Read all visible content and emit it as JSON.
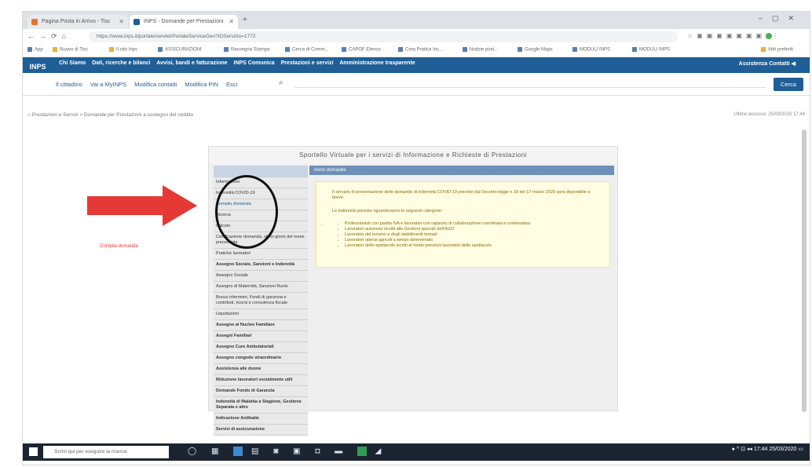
{
  "browser": {
    "tabs": [
      {
        "label": "Pagina Posta in Arrivo - Tisc",
        "favicon_color": "#e8742a"
      },
      {
        "label": "INPS - Domande per Prestazioni",
        "favicon_color": "#1f5e96"
      }
    ],
    "url": "https://www.inps.it/portale/servlet/PortaleServiceGen?IDServizio=1772",
    "bookmarks": [
      "App",
      "Nuovo di Tisc",
      "Il sito Inps",
      "ASSICURAZIONI",
      "Rassegna Stampa",
      "Cerca di Comm...",
      "CAPOF Elenco",
      "Crea Pratica Inc...",
      "Notizie post...",
      "Google Maps",
      "MODULI INPS",
      "MODULI INPS",
      "Altri preferiti"
    ]
  },
  "site": {
    "logo_text": "INPS",
    "top_nav": [
      "Chi Siamo",
      "Dati, ricerche e bilanci",
      "Avvisi, bandi e fatturazione",
      "INPS Comunica",
      "Prestazioni e servizi",
      "Amministrazione trasparente"
    ],
    "top_right": [
      "Assistenza",
      "Contatti"
    ],
    "sub_nav": [
      "Il cittadino",
      "Vai a MyINPS",
      "Modifica contatti",
      "Modifica PIN",
      "Esci"
    ],
    "search_button": "Cerca",
    "breadcrumb": "Prestazioni e Servizi > Domande per Prestazioni a sostegno del reddito",
    "last_update": "Ultimo accesso: 25/03/2020 17:44"
  },
  "portal": {
    "title": "Sportello Virtuale per i servizi di Informazione e Richieste di Prestazioni",
    "menu": [
      {
        "label": "",
        "style": "head"
      },
      {
        "label": "Informazioni",
        "style": "normal"
      },
      {
        "label": "Indennità COVID-19",
        "style": "normal"
      },
      {
        "label": "Compila domanda",
        "style": "sub"
      },
      {
        "label": "Ricerca",
        "style": "normal"
      },
      {
        "label": "Calcolo",
        "style": "normal"
      },
      {
        "label": "Certificazione domanda, ultimi giorni del mese precedente",
        "style": "normal"
      },
      {
        "label": "Pratiche lavoratori",
        "style": "normal"
      },
      {
        "label": "Assegno Sociale, Sanzioni e Indennità",
        "style": "bold"
      },
      {
        "label": "Assegno Sociale",
        "style": "normal"
      },
      {
        "label": "Assegno di Maternità, Sanzioni Ruolo",
        "style": "normal"
      },
      {
        "label": "Bonus infermieri, Fondi di garanzia e contributi, ricorsi e consulenza fiscale",
        "style": "normal"
      },
      {
        "label": "Liquidazioni",
        "style": "normal"
      },
      {
        "label": "Assegno al Nucleo Familiare",
        "style": "bold"
      },
      {
        "label": "Assegni Familiari",
        "style": "bold"
      },
      {
        "label": "Assegno Cure Ambulatoriali",
        "style": "bold"
      },
      {
        "label": "Assegno congedo straordinario",
        "style": "bold"
      },
      {
        "label": "Assistenza alle donne",
        "style": "bold"
      },
      {
        "label": "Riduzione lavoratori socialmente utili",
        "style": "bold"
      },
      {
        "label": "Domande Fondo di Garanzia",
        "style": "bold"
      },
      {
        "label": "Indennità di Malattia a Stagione, Gestione Separata e altre",
        "style": "bold"
      },
      {
        "label": "Indicazione Antibatte",
        "style": "bold"
      },
      {
        "label": "Servizi di assicurazione",
        "style": "bold"
      }
    ],
    "panel_header": "Anno domande",
    "intro": "Il servizio di presentazione delle domande di indennità COVID-19 previste dal Decreto-legge n.18 del 17 marzo 2020 sarà disponibile a breve.",
    "intro2": "Le indennità previste riguarderanno le seguenti categorie:",
    "bullets": [
      "Professionisti con partita IVA e lavoratori con rapporto di collaborazione coordinata e continuativa",
      "Lavoratori autonomi iscritti alle Gestioni speciali dell'AGO",
      "Lavoratori del turismo e degli stabilimenti termali",
      "Lavoratori operai agricoli a tempo determinato",
      "Lavoratori dello spettacolo iscritti al fondo pensioni lavoratori dello spettacolo"
    ]
  },
  "annotation": {
    "red_label": "Compila domanda"
  },
  "taskbar": {
    "search_placeholder": "Scrivi qui per eseguire la ricerca",
    "time": "17:44",
    "date": "25/03/2020"
  }
}
